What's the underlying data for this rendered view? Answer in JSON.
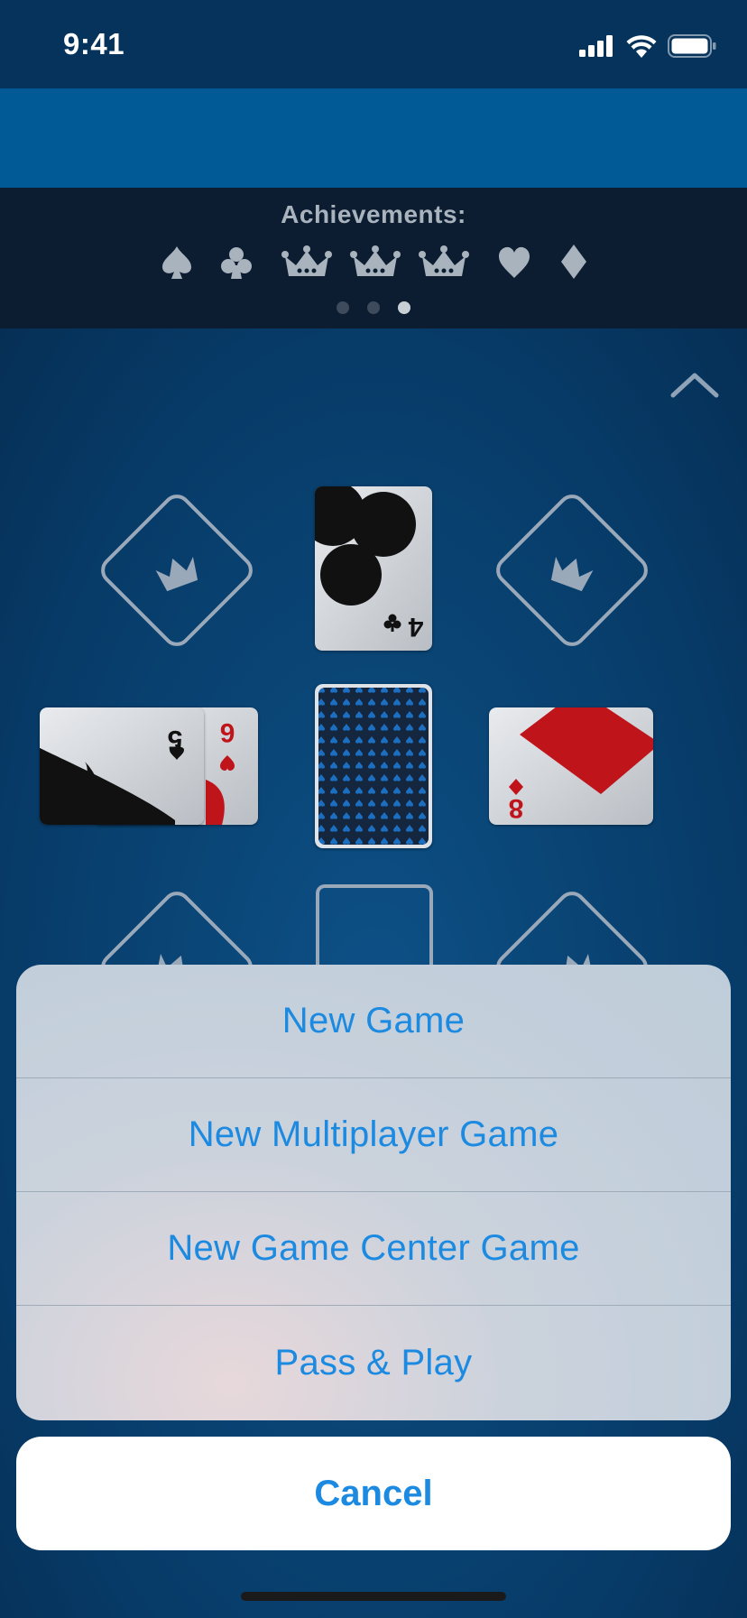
{
  "status_bar": {
    "time": "9:41",
    "icons": [
      "signal-icon",
      "wifi-icon",
      "battery-icon"
    ]
  },
  "achievements": {
    "title": "Achievements:",
    "icons": [
      "spade-icon",
      "club-icon",
      "crown-icon",
      "crown-icon",
      "crown-icon",
      "heart-icon",
      "diamond-icon"
    ],
    "page_count": 3,
    "active_page": 3
  },
  "cards": {
    "top": {
      "rank": "4",
      "suit": "club-icon"
    },
    "left_back": {
      "rank": "6",
      "suit": "heart-icon"
    },
    "left_front": {
      "rank": "5",
      "suit": "spade-icon"
    },
    "right": {
      "rank": "8",
      "suit": "diamond-icon"
    },
    "deck": "card-back"
  },
  "action_sheet": {
    "items": [
      "New Game",
      "New Multiplayer Game",
      "New Game Center Game",
      "Pass & Play"
    ],
    "cancel": "Cancel"
  },
  "colors": {
    "accent": "#1b8ae0",
    "card_red": "#c0141b",
    "table": "#0a4677",
    "nav": "#015a96"
  }
}
